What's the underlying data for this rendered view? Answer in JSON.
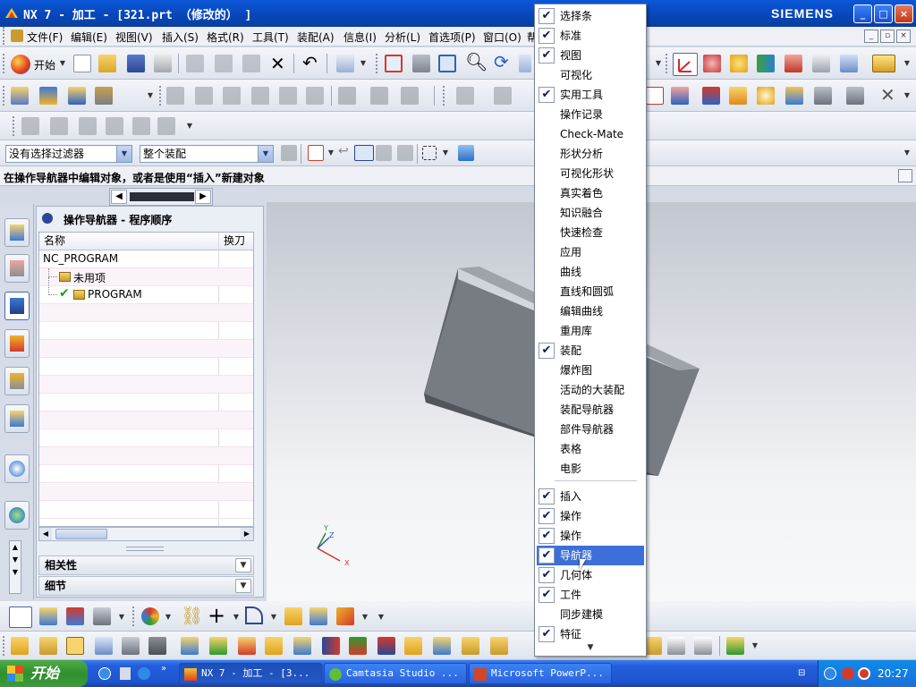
{
  "window": {
    "title": "NX 7 - 加工 - [321.prt （修改的） ]",
    "brand": "SIEMENS",
    "controls": [
      "_",
      "□",
      "×"
    ]
  },
  "menubar": {
    "items": [
      "文件(F)",
      "编辑(E)",
      "视图(V)",
      "插入(S)",
      "格式(R)",
      "工具(T)",
      "装配(A)",
      "信息(I)",
      "分析(L)",
      "首选项(P)",
      "窗口(O)",
      "帮"
    ]
  },
  "toolbar": {
    "start_label": "开始",
    "filter_combo": "没有选择过滤器",
    "assembly_combo": "整个装配"
  },
  "status": {
    "prompt": "在操作导航器中编辑对象，或者是使用“插入”新建对象"
  },
  "navigator": {
    "title": "操作导航器 - 程序顺序",
    "columns": [
      "名称",
      "换刀"
    ],
    "rows": [
      {
        "name": "NC_PROGRAM"
      },
      {
        "name": "未用项"
      },
      {
        "name": "PROGRAM"
      }
    ],
    "sections": [
      "相关性",
      "细节"
    ]
  },
  "viewport": {
    "axis_labels": {
      "x": "X",
      "y": "Y",
      "z": "Z"
    },
    "colors": {
      "block_front": "#777c82",
      "block_top": "#9ea3a9",
      "block_side": "#5e6368"
    }
  },
  "dropdown": {
    "items": [
      {
        "label": "选择条",
        "checked": true
      },
      {
        "label": "标准",
        "checked": true
      },
      {
        "label": "视图",
        "checked": true
      },
      {
        "label": "可视化",
        "checked": false
      },
      {
        "label": "实用工具",
        "checked": true
      },
      {
        "label": "操作记录",
        "checked": false
      },
      {
        "label": "Check-Mate",
        "checked": false
      },
      {
        "label": "形状分析",
        "checked": false
      },
      {
        "label": "可视化形状",
        "checked": false
      },
      {
        "label": "真实着色",
        "checked": false
      },
      {
        "label": "知识融合",
        "checked": false
      },
      {
        "label": "快速检查",
        "checked": false
      },
      {
        "label": "应用",
        "checked": false
      },
      {
        "label": "曲线",
        "checked": false
      },
      {
        "label": "直线和圆弧",
        "checked": false
      },
      {
        "label": "编辑曲线",
        "checked": false
      },
      {
        "label": "重用库",
        "checked": false
      },
      {
        "label": "装配",
        "checked": true
      },
      {
        "label": "爆炸图",
        "checked": false
      },
      {
        "label": "活动的大装配",
        "checked": false
      },
      {
        "label": "装配导航器",
        "checked": false
      },
      {
        "label": "部件导航器",
        "checked": false
      },
      {
        "label": "表格",
        "checked": false
      },
      {
        "label": "电影",
        "checked": false
      },
      {
        "label": "插入",
        "checked": true
      },
      {
        "label": "操作",
        "checked": true
      },
      {
        "label": "操作",
        "checked": true
      },
      {
        "label": "导航器",
        "checked": true,
        "highlighted": true
      },
      {
        "label": "几何体",
        "checked": true
      },
      {
        "label": "工件",
        "checked": true
      },
      {
        "label": "同步建模",
        "checked": false
      },
      {
        "label": "特征",
        "checked": true
      }
    ],
    "more_arrow": "▼"
  },
  "taskbar": {
    "start": "开始",
    "tasks": [
      "NX 7 - 加工 - [3...",
      "Camtasia Studio ...",
      "Microsoft PowerP..."
    ],
    "clock": "20:27"
  }
}
